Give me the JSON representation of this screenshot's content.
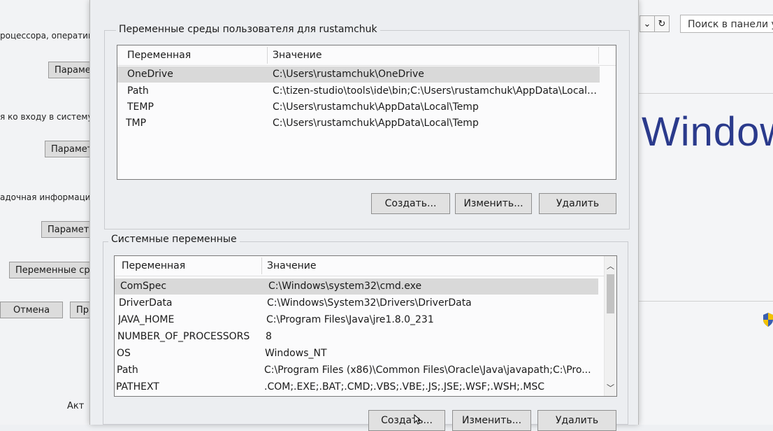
{
  "background": {
    "left_panel": {
      "line1": "роцессора, оперативн",
      "btn1": "Параметры",
      "line2": "я ко входу в систему",
      "btn2": "Параметры",
      "line3": "адочная информация",
      "btn3": "Параметры",
      "env_btn": "Переменные сре",
      "cancel_btn": "Отмена",
      "apply_btn": "Пр",
      "bottom_text": "Акт"
    },
    "right_panel": {
      "search_placeholder": "Поиск в панели у",
      "windows_logo_text": "Window",
      "refresh_icon": "refresh-icon",
      "dropdown_icon": "chevron-down-icon",
      "shield_icon": "shield-icon"
    }
  },
  "dialog": {
    "user_group_title": "Переменные среды пользователя для rustamchuk",
    "user_headers": {
      "variable": "Переменная",
      "value": "Значение"
    },
    "user_vars": [
      {
        "name": "OneDrive",
        "value": "C:\\Users\\rustamchuk\\OneDrive"
      },
      {
        "name": "Path",
        "value": "C:\\tizen-studio\\tools\\ide\\bin;C:\\Users\\rustamchuk\\AppData\\Local\\..."
      },
      {
        "name": "TEMP",
        "value": "C:\\Users\\rustamchuk\\AppData\\Local\\Temp"
      },
      {
        "name": "TMP",
        "value": "C:\\Users\\rustamchuk\\AppData\\Local\\Temp"
      }
    ],
    "user_buttons": {
      "create": "Создать...",
      "edit": "Изменить...",
      "delete": "Удалить"
    },
    "system_group_title": "Системные переменные",
    "system_headers": {
      "variable": "Переменная",
      "value": "Значение"
    },
    "system_vars": [
      {
        "name": "ComSpec",
        "value": "C:\\Windows\\system32\\cmd.exe"
      },
      {
        "name": "DriverData",
        "value": "C:\\Windows\\System32\\Drivers\\DriverData"
      },
      {
        "name": "JAVA_HOME",
        "value": "C:\\Program Files\\Java\\jre1.8.0_231"
      },
      {
        "name": "NUMBER_OF_PROCESSORS",
        "value": "8"
      },
      {
        "name": "OS",
        "value": "Windows_NT"
      },
      {
        "name": "Path",
        "value": "C:\\Program Files (x86)\\Common Files\\Oracle\\Java\\javapath;C:\\Pro..."
      },
      {
        "name": "PATHEXT",
        "value": ".COM;.EXE;.BAT;.CMD;.VBS;.VBE;.JS;.JSE;.WSF;.WSH;.MSC"
      }
    ],
    "system_buttons": {
      "create": "Создать...",
      "edit": "Изменить...",
      "delete": "Удалить"
    },
    "scroll_up_icon": "chevron-up-icon",
    "scroll_down_icon": "chevron-down-icon"
  }
}
